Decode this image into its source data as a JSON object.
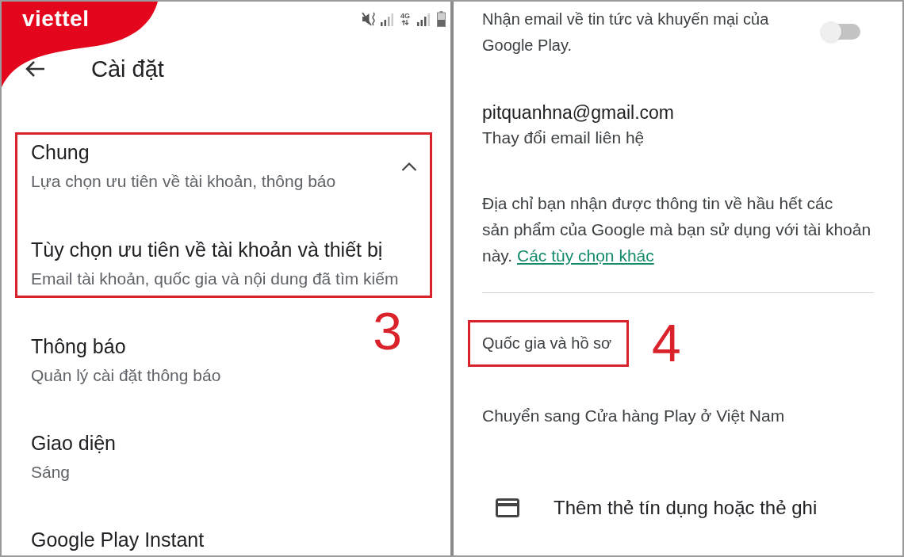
{
  "left_screen": {
    "carrier": "viettel",
    "network_type": "4G",
    "title": "Cài đặt",
    "highlight_number": "3",
    "group": {
      "title": "Chung",
      "subtitle": "Lựa chọn ưu tiên về tài khoản, thông báo",
      "expanded": true,
      "highlighted": true
    },
    "items": [
      {
        "title": "Tùy chọn ưu tiên về tài khoản và thiết bị",
        "subtitle": "Email tài khoản, quốc gia và nội dung đã tìm kiếm",
        "highlighted": true
      },
      {
        "title": "Thông báo",
        "subtitle": "Quản lý cài đặt thông báo",
        "highlighted": false
      },
      {
        "title": "Giao diện",
        "subtitle": "Sáng",
        "highlighted": false
      },
      {
        "title": "Google Play Instant",
        "highlighted": false
      }
    ]
  },
  "right_screen": {
    "promo_email": {
      "label": "Nhận email về tin tức và khuyến mại của Google Play.",
      "on": false
    },
    "contact_email": {
      "address": "pitquanhna@gmail.com",
      "action": "Thay đổi email liên hệ"
    },
    "info": {
      "lines": [
        "Địa chỉ bạn nhận được thông tin về hầu hết các",
        "sản phẩm của Google mà bạn sử dụng với tài khoản",
        "này."
      ],
      "link": "Các tùy chọn khác"
    },
    "country_profile": {
      "label": "Quốc gia và hồ sơ",
      "highlighted": true,
      "highlight_number": "4"
    },
    "switch_store": "Chuyển sang Cửa hàng Play ở Việt Nam",
    "add_card": "Thêm thẻ tín dụng hoặc thẻ ghi"
  }
}
